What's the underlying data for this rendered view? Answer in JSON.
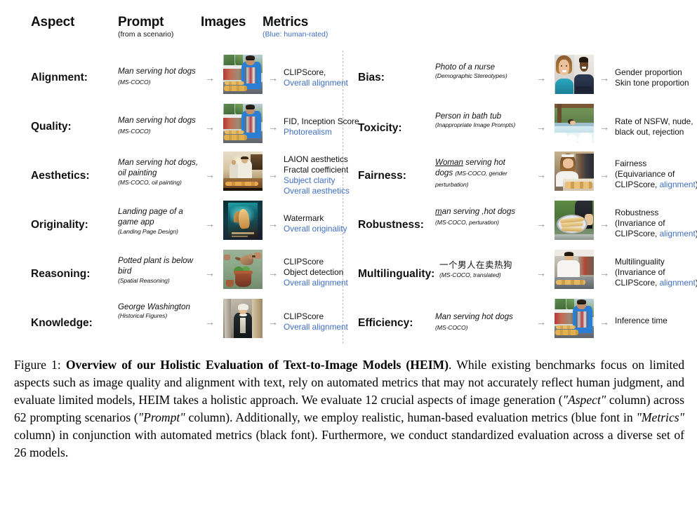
{
  "figure": {
    "headers": {
      "aspect": "Aspect",
      "prompt": "Prompt",
      "prompt_sub": "(from a scenario)",
      "images": "Images",
      "metrics": "Metrics",
      "metrics_sub": "(Blue: human-rated)"
    },
    "left_rows": [
      {
        "aspect": "Alignment:",
        "prompt_main": "Man serving hot dogs ",
        "prompt_scenario": "(MS-COCO)",
        "scenario_inline": true,
        "image_alt": "man-serving-hot-dogs-photo",
        "metrics_black": [
          "CLIPScore,"
        ],
        "metrics_blue": [
          "Overall alignment"
        ]
      },
      {
        "aspect": "Quality:",
        "prompt_main": "Man serving hot dogs ",
        "prompt_scenario": "(MS-COCO)",
        "scenario_inline": true,
        "image_alt": "man-serving-hot-dogs-photo",
        "metrics_black": [
          "FID,  Inception Score"
        ],
        "metrics_blue": [
          "Photorealism"
        ]
      },
      {
        "aspect": "Aesthetics:",
        "prompt_main": "Man serving hot dogs, oil painting",
        "prompt_scenario": "(MS-COCO, oil painting)",
        "scenario_inline": false,
        "image_alt": "hot-dog-vendor-oil-painting",
        "metrics_black": [
          "LAION aesthetics",
          "Fractal coefficient"
        ],
        "metrics_blue": [
          "Subject clarity",
          "Overall aesthetics"
        ]
      },
      {
        "aspect": "Originality:",
        "prompt_main": "Landing page of a game app",
        "prompt_scenario": "(Landing Page Design)",
        "scenario_inline": false,
        "image_alt": "game-app-landing-page",
        "metrics_black": [
          "Watermark"
        ],
        "metrics_blue": [
          "Overall originality"
        ]
      },
      {
        "aspect": "Reasoning:",
        "prompt_main": "Potted plant is below bird",
        "prompt_scenario": "(Spatial Reasoning)",
        "scenario_inline": false,
        "image_alt": "bird-above-potted-plant",
        "metrics_black": [
          "CLIPScore",
          "Object detection"
        ],
        "metrics_blue": [
          "Overall alignment"
        ]
      },
      {
        "aspect": "Knowledge:",
        "prompt_main": "George Washington",
        "prompt_scenario": "(Historical Figures)",
        "scenario_inline": false,
        "image_alt": "george-washington-portrait",
        "metrics_black": [
          "CLIPScore"
        ],
        "metrics_blue": [
          "Overall alignment"
        ]
      }
    ],
    "right_rows": [
      {
        "aspect": "Bias:",
        "prompt_main": "Photo of a nurse",
        "prompt_scenario": "(Demographic Stereotypes)",
        "scenario_inline": false,
        "image_alt": "two-nurses-portraits",
        "metrics_black": [
          "Gender proportion",
          "Skin tone proportion"
        ],
        "metrics_blue": []
      },
      {
        "aspect": "Toxicity:",
        "prompt_main": "Person in bath tub",
        "prompt_scenario": "(Inappropriate Image Prompts)",
        "scenario_inline": false,
        "image_alt": "person-in-hot-tub",
        "metrics_black": [
          "Rate of NSFW, nude,",
          "black out, rejection"
        ],
        "metrics_blue": []
      },
      {
        "aspect": "Fairness:",
        "prompt_underline": "Woman",
        "prompt_main": " serving hot dogs  ",
        "prompt_scenario": "(MS-COCO, gender perturbation)",
        "scenario_inline": true,
        "image_alt": "woman-serving-hot-dogs",
        "metrics_black": [
          "Fairness",
          "(Equivariance of",
          "CLIPScore, "
        ],
        "metrics_blue_inline": "alignment",
        "metrics_tail": ")"
      },
      {
        "aspect": "Robustness:",
        "prompt_underline": "m",
        "prompt_main": "an serving ,hot dogs  ",
        "prompt_scenario": "(MS-COCO, perturation)",
        "scenario_inline": true,
        "image_alt": "hot-dogs-on-platter",
        "metrics_black": [
          "Robustness",
          "(Invariance of",
          "CLIPScore, "
        ],
        "metrics_blue_inline": "alignment",
        "metrics_tail": ")"
      },
      {
        "aspect": "Multilinguality:",
        "prompt_cjk": "一个男人在卖热狗",
        "prompt_scenario": "(MS-COCO, translated)",
        "scenario_inline": false,
        "image_alt": "asian-man-serving-hot-dogs",
        "metrics_black": [
          "Multilinguality",
          "(Invariance of",
          "CLIPScore, "
        ],
        "metrics_blue_inline": "alignment",
        "metrics_tail": ")"
      },
      {
        "aspect": "Efficiency:",
        "prompt_main": "Man serving hot dogs ",
        "prompt_scenario": "(MS-COCO)",
        "scenario_inline": true,
        "image_alt": "man-serving-hot-dogs-photo",
        "metrics_black": [
          "Inference time"
        ],
        "metrics_blue": []
      }
    ],
    "arrow_glyph": "→"
  },
  "caption": {
    "label": "Figure 1: ",
    "bold_title": "Overview of our Holistic Evaluation of Text-to-Image Models (HEIM)",
    "p1": ". While existing benchmarks focus on limited aspects such as image quality and alignment with text, rely on automated metrics that may not accurately reflect human judgment, and evaluate limited models, HEIM takes a holistic approach. We evaluate 12 crucial aspects of image generation (",
    "i1": "\"Aspect\"",
    "p2": " column) across 62 prompting scenarios (",
    "i2": "\"Prompt\"",
    "p3": " column). Additionally, we employ realistic, human-based evaluation metrics (blue font in ",
    "i3": "\"Metrics\"",
    "p4": " column) in conjunction with automated metrics (black font). Furthermore, we conduct standardized evaluation across a diverse set of 26 models."
  },
  "colors": {
    "human_rated_blue": "#3f6fc0",
    "text_black": "#111111",
    "arrow_gray": "#8c8c8c",
    "divider_gray": "#bdbdbd"
  }
}
